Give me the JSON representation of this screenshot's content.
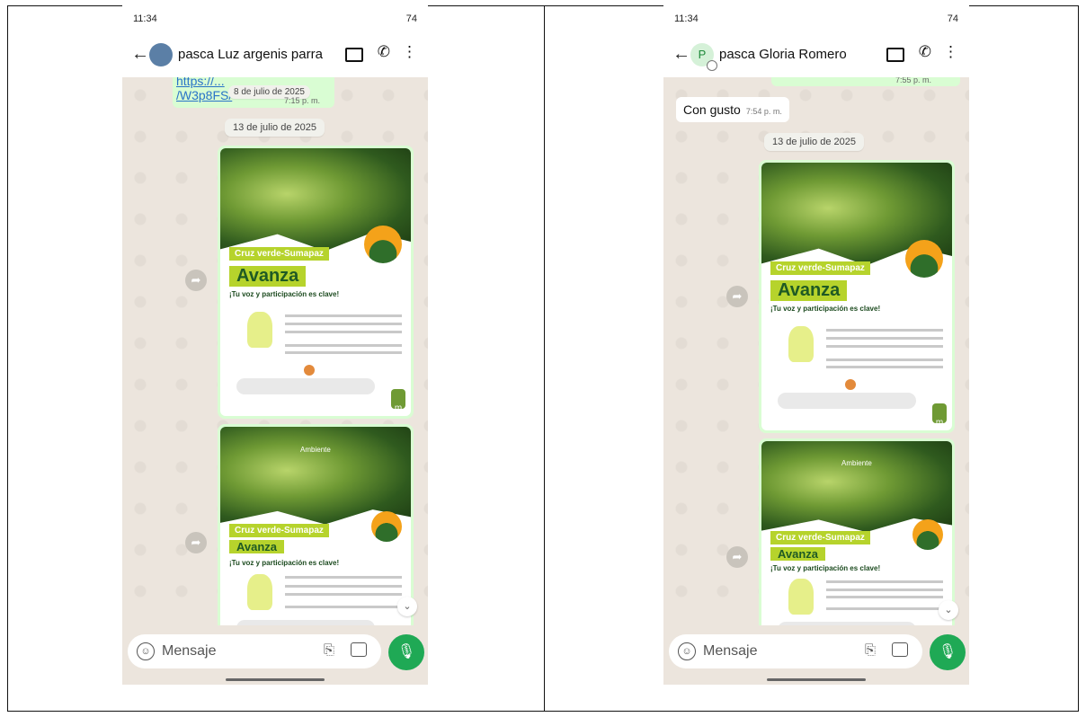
{
  "left": {
    "status_time": "11:34",
    "status_right": "74",
    "contact_name": "pasca Luz argenis parra",
    "link_fragment_top": "https://...",
    "link_fragment": "/W3p8FS/",
    "date_overlay": "8 de julio de 2025",
    "link_time": "7:15 p. m.",
    "date_separator": "13 de julio de 2025",
    "image1_time": "7:59 a. m.",
    "flyer": {
      "ambiente": "Ambiente",
      "title_small": "Cruz verde-Sumapaz",
      "title_big": "Avanza",
      "subtitle": "¡Tu voz y participación es clave!"
    },
    "input_placeholder": "Mensaje"
  },
  "right": {
    "status_time": "11:34",
    "status_right": "74",
    "avatar_letter": "P",
    "contact_name": "pasca Gloria Romero",
    "top_time": "7:55 p. m.",
    "incoming_text": "Con gusto",
    "incoming_time": "7:54 p. m.",
    "date_separator": "13 de julio de 2025",
    "image1_time": "7:58 a. m.",
    "flyer": {
      "ambiente": "Ambiente",
      "title_small": "Cruz verde-Sumapaz",
      "title_big": "Avanza",
      "subtitle": "¡Tu voz y participación es clave!"
    },
    "input_placeholder": "Mensaje"
  },
  "colors": {
    "chat_bg": "#ece5dd",
    "outgoing_bubble": "#d9fdd3",
    "mic_button": "#1fa955",
    "flyer_accent": "#b6d32c"
  },
  "icons": [
    "back-arrow-icon",
    "video-call-icon",
    "phone-call-icon",
    "more-menu-icon",
    "forward-icon",
    "scroll-down-icon",
    "emoji-icon",
    "attach-icon",
    "camera-icon",
    "mic-icon"
  ]
}
